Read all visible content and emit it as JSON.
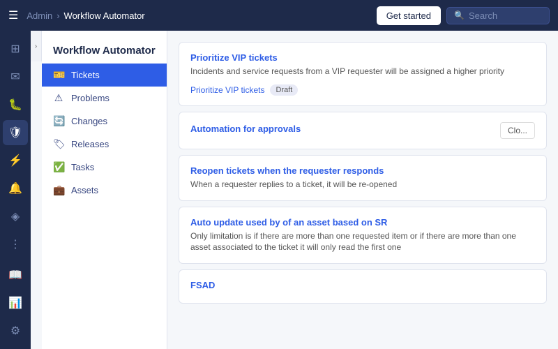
{
  "topbar": {
    "breadcrumb_admin": "Admin",
    "breadcrumb_sep": "›",
    "breadcrumb_current": "Workflow Automator",
    "get_started_label": "Get started",
    "search_placeholder": "Search"
  },
  "page": {
    "title": "Workflow Automator"
  },
  "icon_sidebar": {
    "icons": [
      {
        "name": "home-icon",
        "glyph": "⊞",
        "active": false
      },
      {
        "name": "inbox-icon",
        "glyph": "✉",
        "active": false
      },
      {
        "name": "bug-icon",
        "glyph": "🐛",
        "active": false
      },
      {
        "name": "shield-icon",
        "glyph": "🛡",
        "active": true
      },
      {
        "name": "zap-icon",
        "glyph": "⚡",
        "active": false
      },
      {
        "name": "alert-icon",
        "glyph": "🔔",
        "active": false
      },
      {
        "name": "layers-icon",
        "glyph": "⊕",
        "active": false
      },
      {
        "name": "dots-icon",
        "glyph": "⋮",
        "active": false
      },
      {
        "name": "book-icon",
        "glyph": "📖",
        "active": false
      },
      {
        "name": "chart-icon",
        "glyph": "📊",
        "active": false
      },
      {
        "name": "settings-icon",
        "glyph": "⚙",
        "active": false
      }
    ]
  },
  "nav": {
    "items": [
      {
        "id": "tickets",
        "label": "Tickets",
        "icon": "🎫",
        "active": true
      },
      {
        "id": "problems",
        "label": "Problems",
        "icon": "⚠",
        "active": false
      },
      {
        "id": "changes",
        "label": "Changes",
        "icon": "🔄",
        "active": false
      },
      {
        "id": "releases",
        "label": "Releases",
        "icon": "🏷",
        "active": false
      },
      {
        "id": "tasks",
        "label": "Tasks",
        "icon": "✅",
        "active": false
      },
      {
        "id": "assets",
        "label": "Assets",
        "icon": "💼",
        "active": false
      }
    ]
  },
  "cards": [
    {
      "id": "vip-tickets",
      "title": "Prioritize VIP tickets",
      "description": "Incidents and service requests from a VIP requester will be assigned a higher priority",
      "footer_title": "Prioritize VIP tickets",
      "badge": "Draft",
      "has_close": false
    },
    {
      "id": "approvals",
      "title": "Automation for approvals",
      "description": "",
      "footer_title": "",
      "badge": "",
      "has_close": true,
      "close_label": "Clo..."
    },
    {
      "id": "reopen-tickets",
      "title": "Reopen tickets when the requester responds",
      "description": "When a requester replies to a ticket, it will be re-opened",
      "footer_title": "",
      "badge": "",
      "has_close": false
    },
    {
      "id": "auto-update",
      "title": "Auto update used by of an asset based on SR",
      "description": "Only limitation is if there are more than one requested item or if there are more than one asset associated to the ticket it will only read the first one",
      "footer_title": "",
      "badge": "",
      "has_close": false
    },
    {
      "id": "fsad",
      "title": "FSAD",
      "description": "",
      "footer_title": "",
      "badge": "",
      "has_close": false
    }
  ]
}
